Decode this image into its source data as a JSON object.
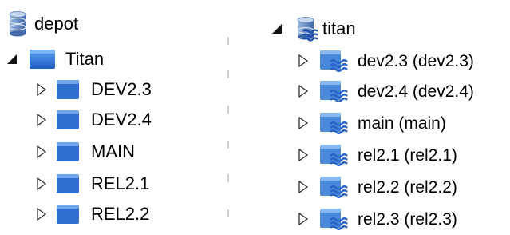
{
  "left_tree": {
    "root": {
      "label": "depot",
      "icon": "database-icon"
    },
    "project": {
      "label": "Titan",
      "icon": "folder-icon",
      "expanded": true
    },
    "items": [
      {
        "label": "DEV2.3",
        "icon": "folder-icon"
      },
      {
        "label": "DEV2.4",
        "icon": "folder-icon"
      },
      {
        "label": "MAIN",
        "icon": "folder-icon"
      },
      {
        "label": "REL2.1",
        "icon": "folder-icon"
      },
      {
        "label": "REL2.2",
        "icon": "folder-icon"
      }
    ]
  },
  "right_tree": {
    "root": {
      "label": "titan",
      "icon": "stream-depot-icon",
      "expanded": true
    },
    "items": [
      {
        "label": "dev2.3 (dev2.3)",
        "icon": "stream-folder-icon"
      },
      {
        "label": "dev2.4 (dev2.4)",
        "icon": "stream-folder-icon"
      },
      {
        "label": "main (main)",
        "icon": "stream-folder-icon"
      },
      {
        "label": "rel2.1 (rel2.1)",
        "icon": "stream-folder-icon"
      },
      {
        "label": "rel2.2 (rel2.2)",
        "icon": "stream-folder-icon"
      },
      {
        "label": "rel2.3 (rel2.3)",
        "icon": "stream-folder-icon"
      }
    ]
  },
  "colors": {
    "folder_blue": "#2f6fd0",
    "stream_wave": "#2a63c7",
    "db_blue": "#3a7bd5"
  }
}
